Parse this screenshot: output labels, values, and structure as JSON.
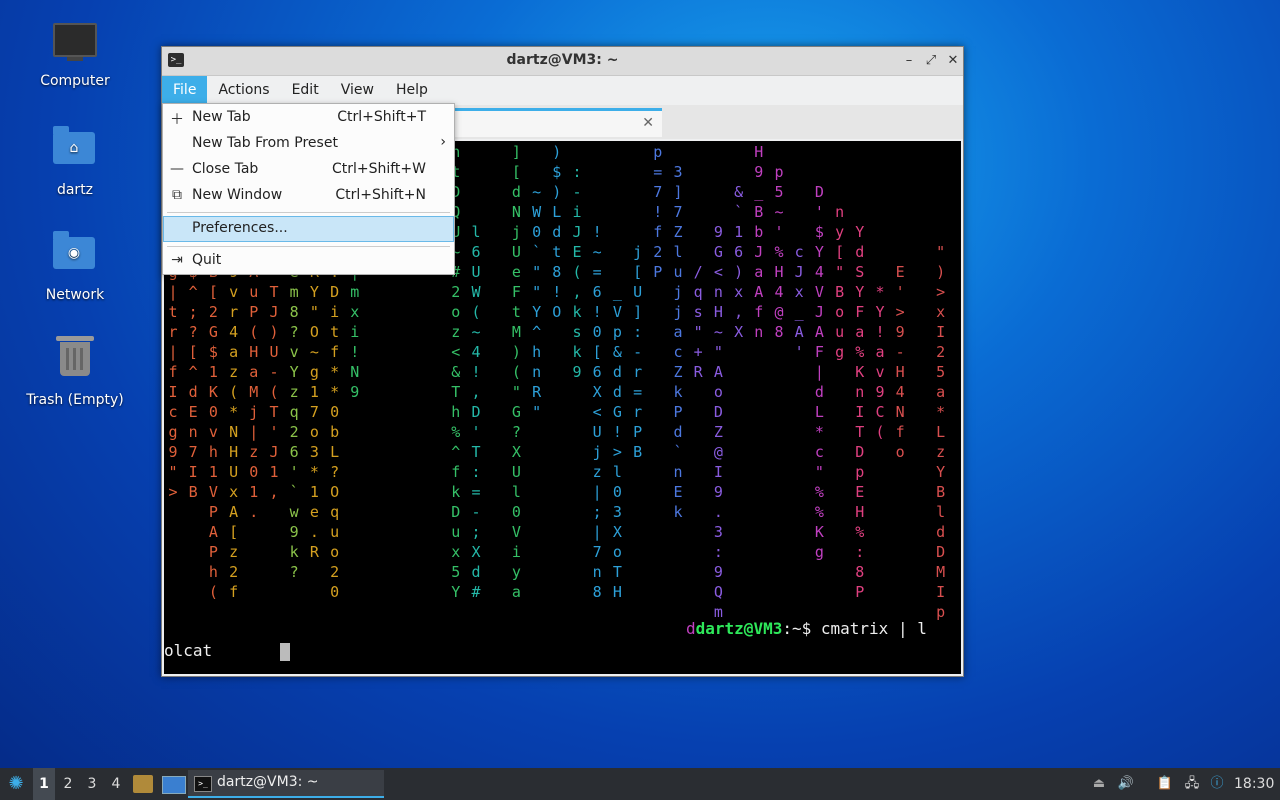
{
  "desktop": {
    "icons": [
      {
        "label": "Computer",
        "icon": "computer-icon"
      },
      {
        "label": "dartz",
        "icon": "home-folder-icon"
      },
      {
        "label": "Network",
        "icon": "network-folder-icon"
      },
      {
        "label": "Trash (Empty)",
        "icon": "trash-icon"
      }
    ]
  },
  "window": {
    "title": "dartz@VM3: ~",
    "app_icon": ">_",
    "controls": {
      "minimize": "–",
      "maximize": "⤢",
      "close": "✕"
    }
  },
  "menubar": {
    "items": [
      "File",
      "Actions",
      "Edit",
      "View",
      "Help"
    ],
    "active": "File"
  },
  "tab": {
    "close": "✕"
  },
  "file_menu": {
    "items": [
      {
        "label": "New Tab",
        "shortcut": "Ctrl+Shift+T",
        "icon": "plus-icon"
      },
      {
        "label": "New Tab From Preset",
        "shortcut": "",
        "icon": "",
        "submenu": "›"
      },
      {
        "label": "Close Tab",
        "shortcut": "Ctrl+Shift+W",
        "icon": "minus-icon"
      },
      {
        "label": "New Window",
        "shortcut": "Ctrl+Shift+N",
        "icon": "new-window-icon"
      },
      {
        "label": "Preferences...",
        "shortcut": "",
        "icon": ""
      },
      {
        "label": "Quit",
        "shortcut": "",
        "icon": "quit-icon"
      }
    ],
    "selected": "Preferences..."
  },
  "terminal": {
    "prompt_tail": "d",
    "prompt_host": "dartz@VM3",
    "prompt_path": ":~$ ",
    "command_start": "cmatrix | l",
    "command_wrap": "olcat",
    "matrix_colors": [
      "#d84f4f",
      "#e0603a",
      "#d4a020",
      "#8bc34a",
      "#35c067",
      "#24b8a8",
      "#2da0d8",
      "#4d78e0",
      "#8a5ce0",
      "#c040c0",
      "#e04080"
    ]
  },
  "taskbar": {
    "workspaces": [
      "1",
      "2",
      "3",
      "4"
    ],
    "active_workspace": "1",
    "task_label": "dartz@VM3: ~",
    "clock": "18:30"
  }
}
